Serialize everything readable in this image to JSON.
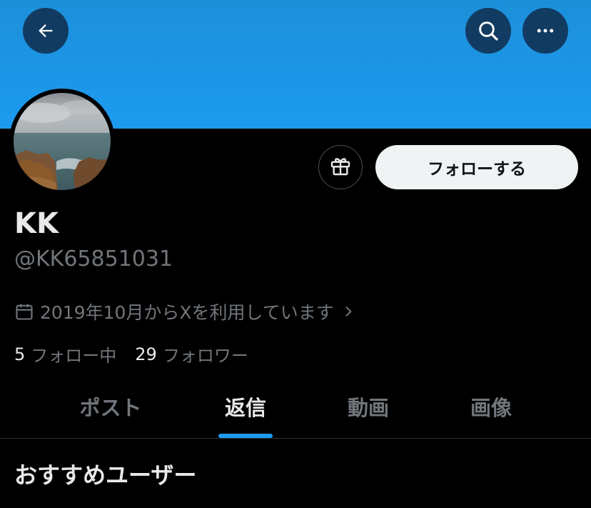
{
  "header": {
    "back_icon": "arrow-left-icon",
    "search_icon": "search-icon",
    "more_icon": "more-horizontal-icon",
    "banner_color": "#1d9bf0"
  },
  "profile": {
    "name": "KK",
    "handle": "@KK65851031",
    "joined": "2019年10月からXを利用しています",
    "following_count": "5",
    "following_label": "フォロー中",
    "followers_count": "29",
    "followers_label": "フォロワー"
  },
  "actions": {
    "gift_icon": "gift-icon",
    "follow_label": "フォローする"
  },
  "tabs": [
    {
      "label": "ポスト",
      "active": false
    },
    {
      "label": "返信",
      "active": true
    },
    {
      "label": "動画",
      "active": false
    },
    {
      "label": "画像",
      "active": false
    }
  ],
  "section": {
    "title": "おすすめユーザー"
  },
  "colors": {
    "accent": "#1d9bf0",
    "background": "#000000",
    "muted_text": "#71767b"
  }
}
